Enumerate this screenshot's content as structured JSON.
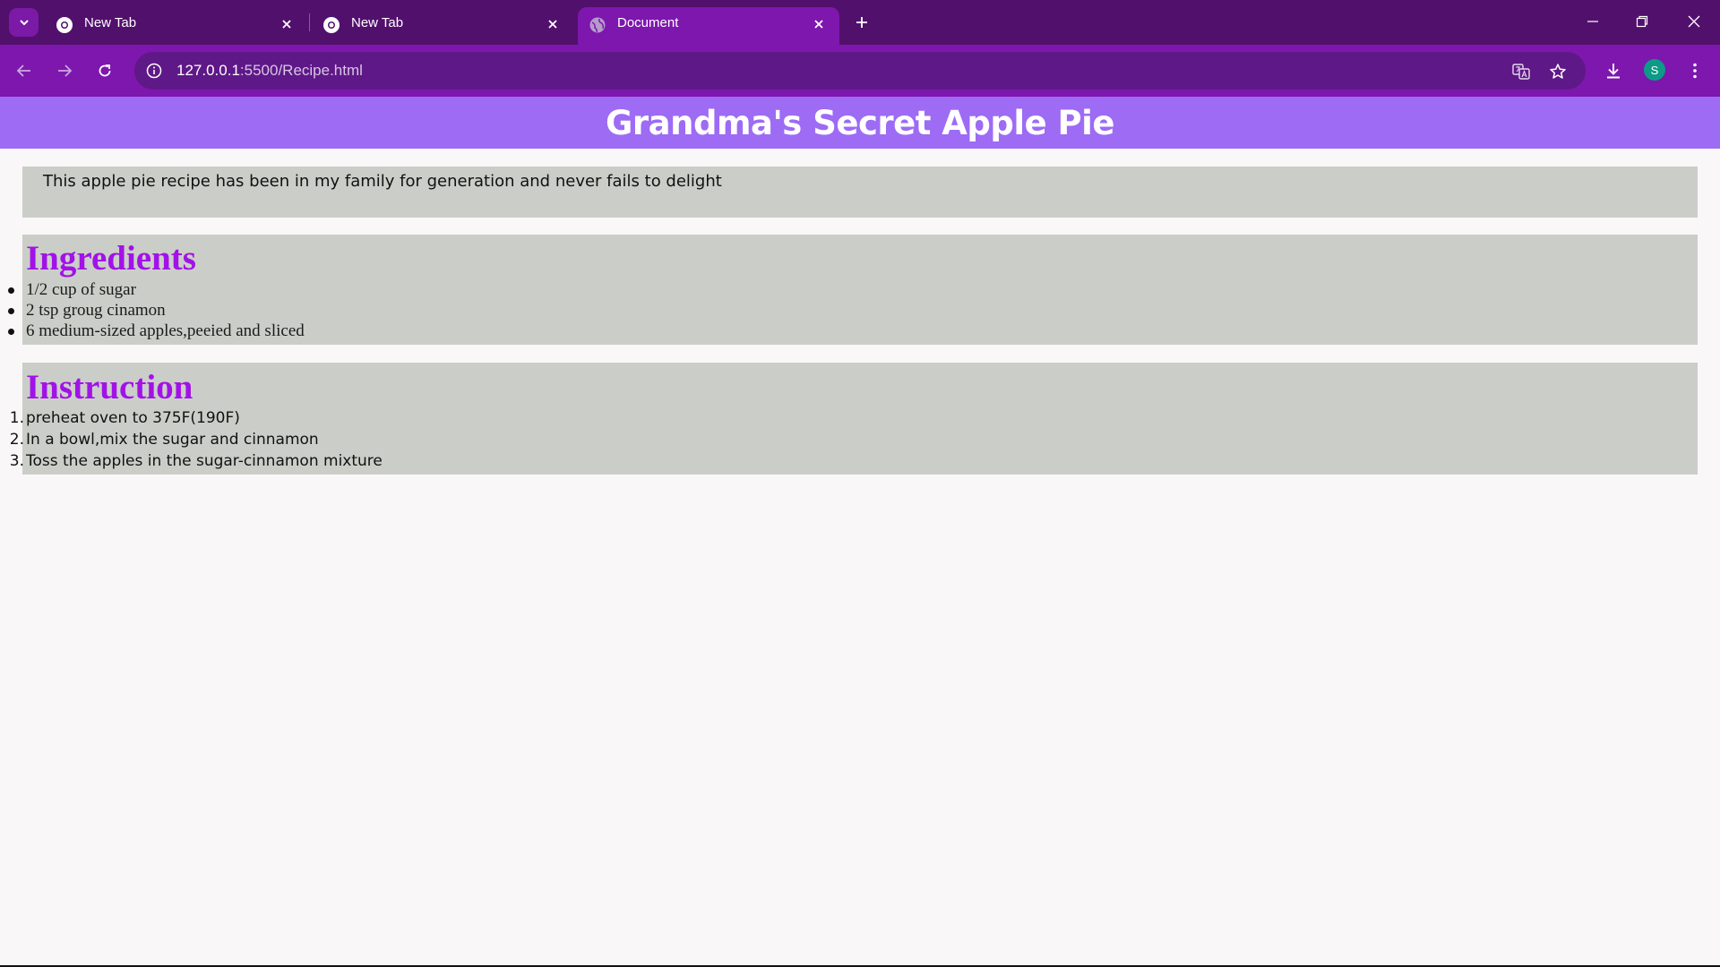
{
  "browser": {
    "tabs": [
      {
        "label": "New Tab",
        "icon": "chrome-icon",
        "active": false
      },
      {
        "label": "New Tab",
        "icon": "chrome-icon",
        "active": false
      },
      {
        "label": "Document",
        "icon": "globe-icon",
        "active": true
      }
    ],
    "url_host": "127.0.0.1",
    "url_path": ":5500/Recipe.html",
    "profile_initial": "S",
    "colors": {
      "tabstrip": "#52106d",
      "toolbar": "#7d17ad",
      "omnibox": "#5e1887"
    }
  },
  "page": {
    "title": "Grandma's Secret Apple Pie",
    "intro": "This apple pie recipe has been in my family for generation and never fails to delight",
    "ingredients": {
      "heading": "Ingredients",
      "items": [
        "1/2 cup of sugar",
        "2 tsp groug cinamon",
        "6 medium-sized apples,peeied and sliced"
      ]
    },
    "instruction": {
      "heading": "Instruction",
      "items": [
        {
          "num": "1.",
          "text": "preheat oven to 375F(190F)"
        },
        {
          "num": "2.",
          "text": "In a bowl,mix the sugar and cinnamon"
        },
        {
          "num": "3.",
          "text": "Toss the apples in the sugar-cinnamon mixture"
        }
      ]
    },
    "colors": {
      "header_bg": "#9d6bf4",
      "box_bg": "#cbcec8",
      "heading": "#a212e8"
    }
  }
}
